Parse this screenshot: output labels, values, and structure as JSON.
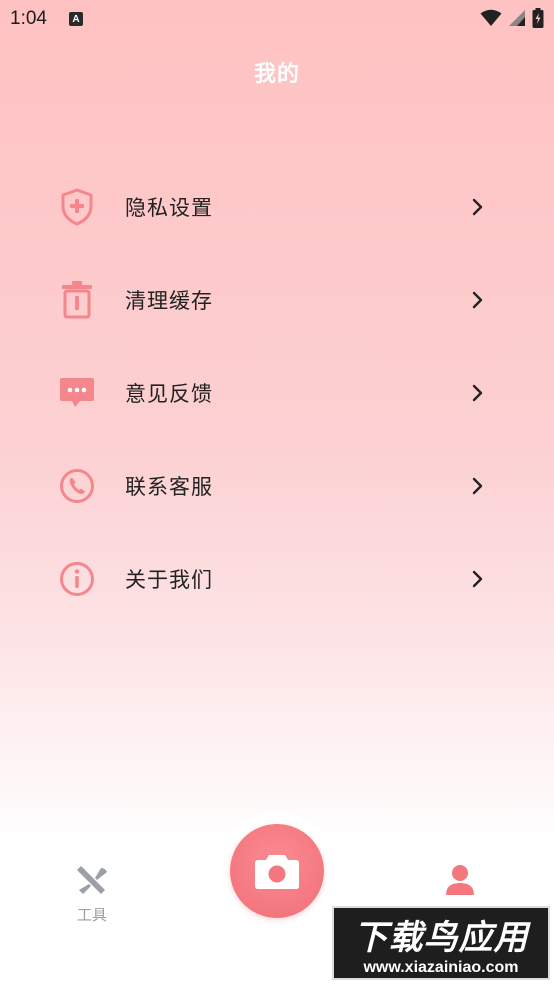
{
  "status_bar": {
    "time": "1:04",
    "notification_badge": "A"
  },
  "header": {
    "title": "我的"
  },
  "menu": {
    "items": [
      {
        "label": "隐私设置",
        "icon": "shield-plus-icon"
      },
      {
        "label": "清理缓存",
        "icon": "trash-icon"
      },
      {
        "label": "意见反馈",
        "icon": "chat-bubble-icon"
      },
      {
        "label": "联系客服",
        "icon": "phone-icon"
      },
      {
        "label": "关于我们",
        "icon": "info-icon"
      }
    ]
  },
  "tab_bar": {
    "tools_label": "工具",
    "camera_icon": "camera-icon",
    "mine_icon": "user-icon"
  },
  "watermark": {
    "title": "下载鸟应用",
    "url": "www.xiazainiao.com"
  },
  "colors": {
    "accent": "#f4777e",
    "icon_pink": "#f5868c",
    "inactive": "#9aa0a6"
  }
}
